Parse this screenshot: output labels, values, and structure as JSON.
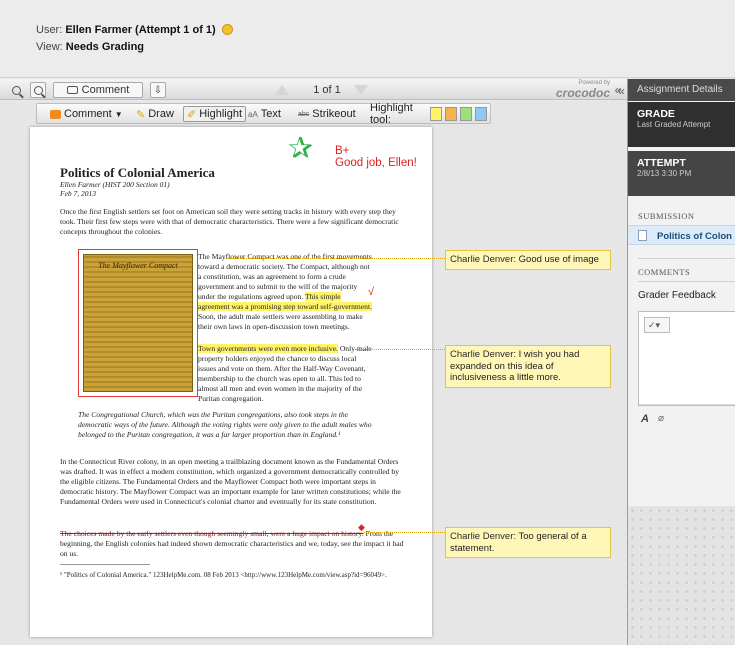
{
  "header": {
    "user_label": "User:",
    "user_value": "Ellen Farmer (Attempt 1 of 1)",
    "view_label": "View:",
    "view_value": "Needs Grading"
  },
  "viewer_toolbar": {
    "comment_label": "Comment",
    "page_indicator": "1 of 1",
    "powered_by": "Powered by",
    "brand": "crocodoc",
    "collapse_glyph": "«"
  },
  "annotation_toolbar": {
    "comment": "Comment",
    "draw": "Draw",
    "highlight": "Highlight",
    "text_label": "Text",
    "strikeout": "Strikeout",
    "highlight_tool_label": "Highlight tool:",
    "highlight_colors": [
      "#fff36a",
      "#f7b34a",
      "#9be07a",
      "#8fc8f0"
    ]
  },
  "document": {
    "title": "Politics of Colonial America",
    "author": "Ellen Farmer (HIST 200 Section 01)",
    "date": "Feb 7, 2013",
    "para1": "Once the first English settlers set foot on American soil they were setting tracks in history with every step they took. Their first few steps were with that of democratic characteristics. There were a few significant democratic concepts throughout the colonies.",
    "image_caption": "The Mayflower Compact",
    "para2_a": "The Mayflower Compact was one of the first movements toward a democratic society. The Compact, although not a constitution, was an agreement to form a crude government and to submit to the will of the majority under the regulations agreed upon.",
    "para2_hl": "This simple agreement was a promising step toward self-government.",
    "para2_b": "Soon, the adult male settlers were assembling to make their own laws in open-discussion town meetings.",
    "para3_hl": "Town governments were even more inclusive.",
    "para3_b": "Only male property holders enjoyed the chance to discuss local issues and vote on them. After the Half-Way Covenant, membership to the church was open to all. This led to almost all men and even women in the majority of the Puritan congregation.",
    "quote": "The Congregational Church, which was the Puritan congregations, also took steps in the democratic ways of the future. Although the voting rights were only given to the adult males who belonged to the Puritan congregation, it was a far larger proportion than in England.¹",
    "para4": "In the Connecticut River colony, in an open meeting a trailblazing document known as the Fundamental Orders was drafted. It was in effect a modern constitution, which organized a government democratically controlled by the eligible citizens. The Fundamental Orders and the Mayflower Compact both were important steps in democratic history. The Mayflower Compact was an important example for later written constitutions; while the Fundamental Orders were used in Connecticut's colonial charter and eventually for its state constitution.",
    "para5_strike": "The choices made by the early settlers even though seemingly small, were a huge impact on history.",
    "para5_b": "From the beginning, the English colonies had indeed shown democratic characteristics and we, today, see the impact it had on us.",
    "footnote": "¹ \"Politics of Colonial America.\" 123HelpMe.com. 08 Feb 2013 <http://www.123HelpMe.com/view.asp?id=96049>.",
    "grade_mark": "B+",
    "grade_comment": "Good job, Ellen!",
    "tick_mark": "√"
  },
  "notes": [
    {
      "author": "Charlie Denver:",
      "text": "Good use of image"
    },
    {
      "author": "Charlie Denver:",
      "text": "I wish you had expanded on this idea of inclusiveness a little more."
    },
    {
      "author": "Charlie Denver:",
      "text": "Too general of a statement."
    }
  ],
  "sidebar": {
    "title": "Assignment Details",
    "grade_label": "GRADE",
    "grade_sub": "Last Graded Attempt",
    "attempt_label": "ATTEMPT",
    "attempt_date": "2/8/13 3:30 PM",
    "submission_label": "SUBMISSION",
    "submission_item": "Politics of Colon",
    "comments_label": "COMMENTS",
    "grader_feedback": "Grader Feedback"
  }
}
